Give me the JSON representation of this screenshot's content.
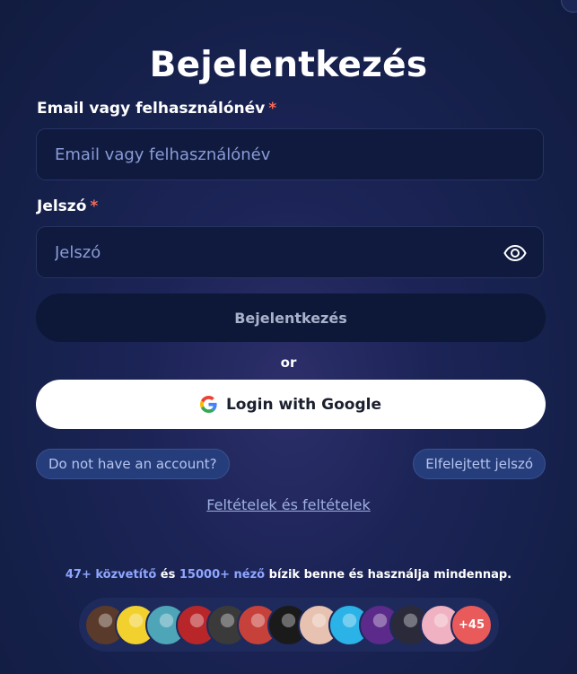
{
  "form": {
    "title": "Bejelentkezés",
    "email_label": "Email vagy felhasználónév",
    "email_placeholder": "Email vagy felhasználónév",
    "password_label": "Jelszó",
    "password_placeholder": "Jelszó",
    "required_mark": "*",
    "submit_label": "Bejelentkezés",
    "or_text": "or",
    "google_label": "Login with Google"
  },
  "links": {
    "no_account": "Do not have an account?",
    "forgot_password": "Elfelejtett jelszó",
    "terms": "Feltételek és feltételek"
  },
  "trust": {
    "streamers": "47+ közvetítő",
    "and": " és ",
    "viewers": "15000+ néző",
    "rest": " bízik benne és használja mindennap."
  },
  "avatars": {
    "colors": [
      "#5a3a2a",
      "#f2d12f",
      "#4fa5b8",
      "#b8262a",
      "#3a3a3a",
      "#c6413a",
      "#1a1a1a",
      "#e8c2b0",
      "#2bb3e8",
      "#5b2a8a",
      "#2a2a3a",
      "#f0b2c2"
    ],
    "more_count": "+45"
  },
  "colors": {
    "accent": "#8ea6ff",
    "required": "#f36b5a",
    "more_badge": "#e95a5a"
  },
  "icons": {
    "password_toggle": "eye-icon",
    "google": "google-logo-icon"
  }
}
